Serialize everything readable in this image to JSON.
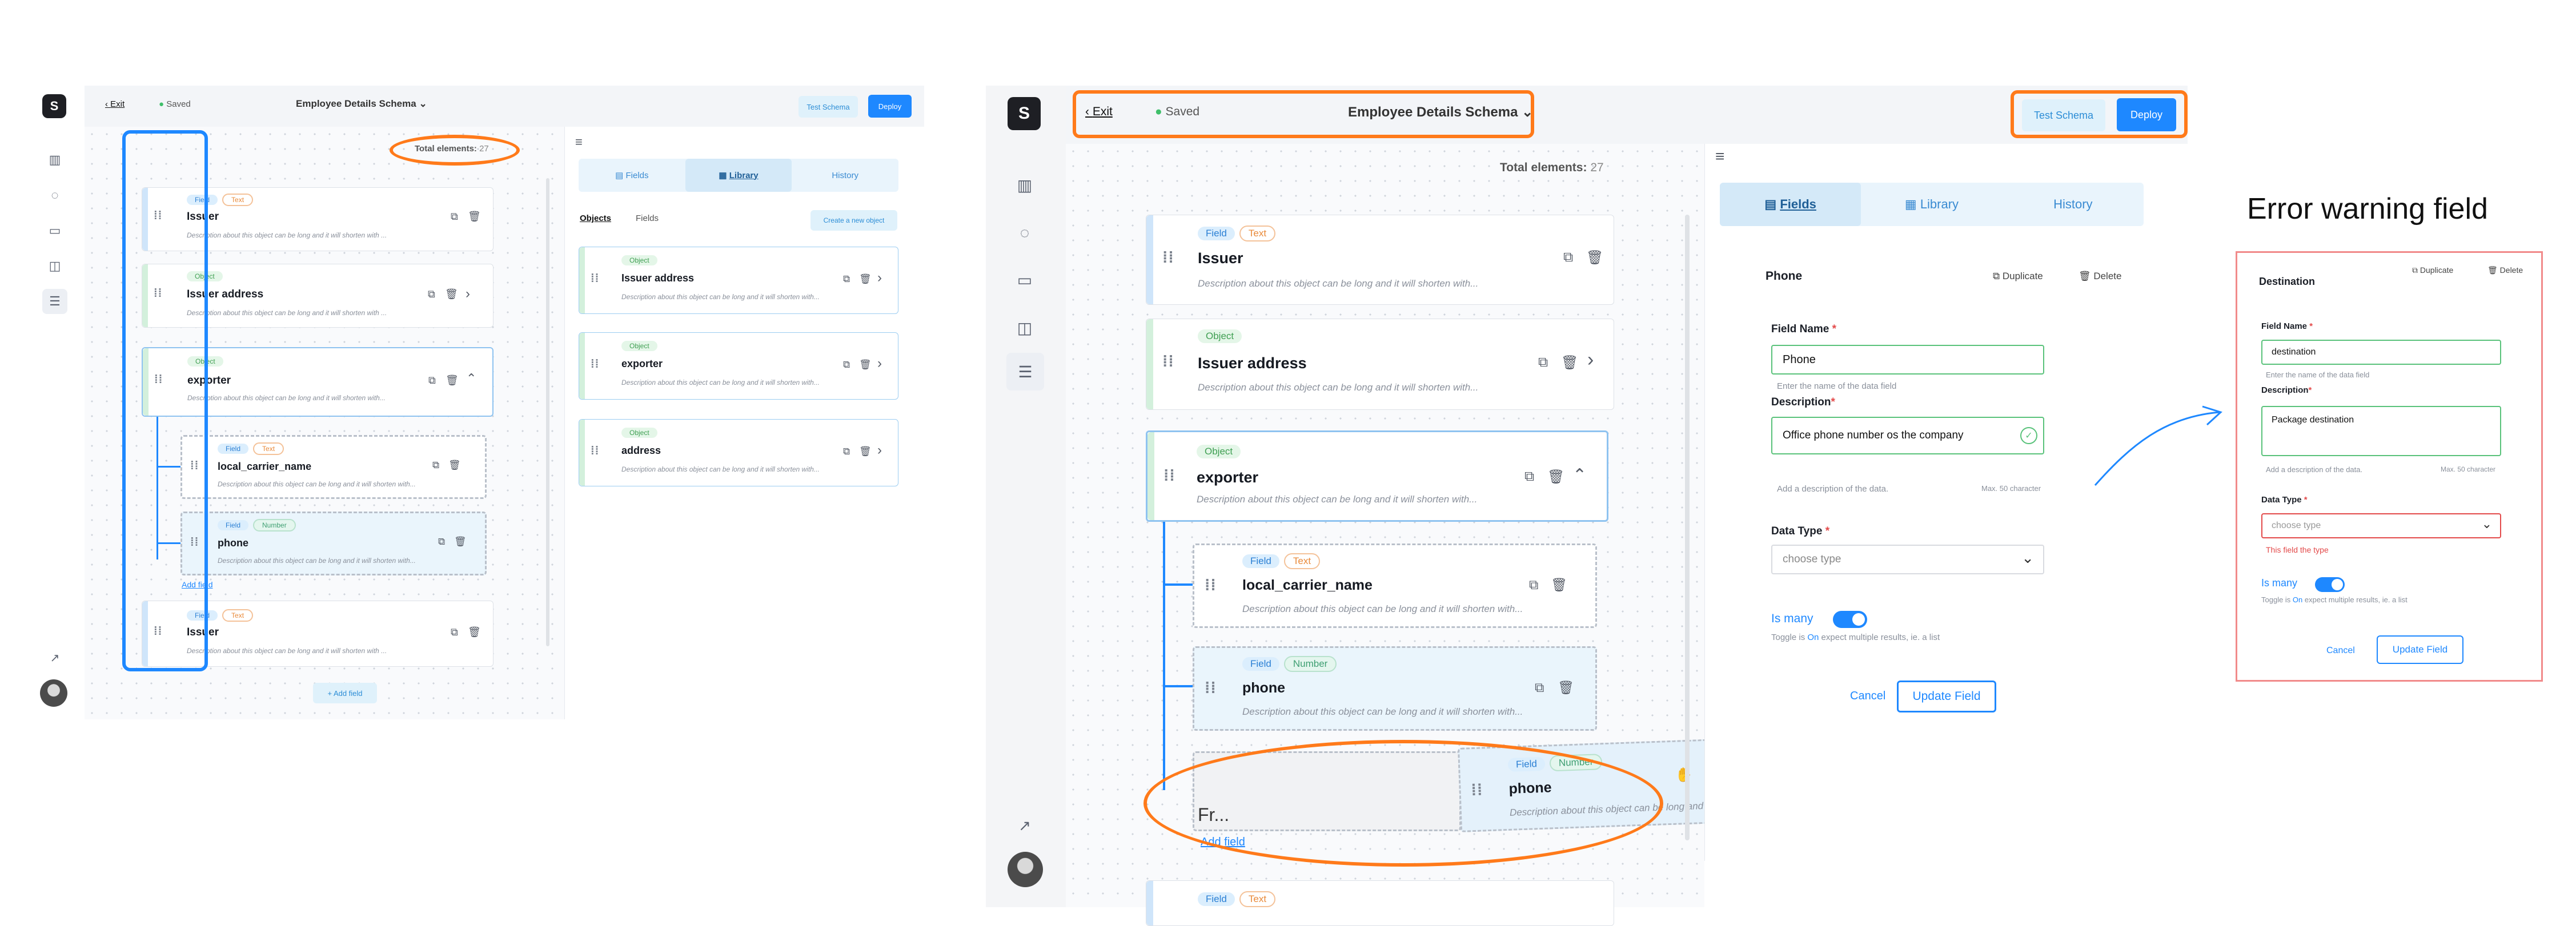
{
  "app": {
    "logo_glyph": "S",
    "exit_label": "Exit",
    "saved_label": "Saved",
    "schema_title": "Employee Details Schema",
    "test_schema_label": "Test Schema",
    "deploy_label": "Deploy",
    "total_label": "Total elements:",
    "total_value": "27"
  },
  "nav_icons": [
    "chart-icon",
    "chat-icon",
    "document-icon",
    "inbox-icon",
    "schema-icon"
  ],
  "left_cards": {
    "issuer": {
      "tag1": "Field",
      "tag2": "Text",
      "title": "Issuer",
      "desc": "Description about this object can be long and it will shorten with ..."
    },
    "issuer_address": {
      "tag1": "Object",
      "title": "Issuer address",
      "desc": "Description about this object can be long and it will shorten with ..."
    },
    "exporter": {
      "tag1": "Object",
      "title": "exporter",
      "desc": "Description about this object can be long and it will shorten with..."
    },
    "local_carrier": {
      "tag1": "Field",
      "tag2": "Text",
      "title": "local_carrier_name",
      "desc": "Description about this object can be long and it will shorten with..."
    },
    "phone": {
      "tag1": "Field",
      "tag2": "Number",
      "title": "phone",
      "desc": "Description about this object can be long and it will shorten with..."
    },
    "issuer2": {
      "tag1": "Field",
      "tag2": "Text",
      "title": "Issuer",
      "desc": "Description about this object can be long and it will shorten with ..."
    },
    "add_field_link": "Add field",
    "add_field_button": "+ Add field"
  },
  "library": {
    "tabs": [
      "Fields",
      "Library",
      "History"
    ],
    "subtabs": [
      "Objects",
      "Fields"
    ],
    "create_label": "Create a new object",
    "items": [
      {
        "tag": "Object",
        "title": "Issuer address",
        "desc": "Description about this object can be long and it will shorten with..."
      },
      {
        "tag": "Object",
        "title": "exporter",
        "desc": "Description about this object can be long and it will shorten with..."
      },
      {
        "tag": "Object",
        "title": "address",
        "desc": "Description about this object can be long and it will shorten with..."
      }
    ]
  },
  "middle_cards": {
    "issuer": {
      "tag1": "Field",
      "tag2": "Text",
      "title": "Issuer",
      "desc": "Description about this object can be long and it will shorten with..."
    },
    "issuer_address": {
      "tag1": "Object",
      "title": "Issuer address",
      "desc": "Description about this object can be long and it will shorten with..."
    },
    "exporter": {
      "tag1": "Object",
      "title": "exporter",
      "desc": "Description about this object can be long and it will shorten with..."
    },
    "local_carrier": {
      "tag1": "Field",
      "tag2": "Text",
      "title": "local_carrier_name",
      "desc": "Description about this object can be long and it will shorten with..."
    },
    "phone": {
      "tag1": "Field",
      "tag2": "Number",
      "title": "phone",
      "desc": "Description about this object can be long and it will shorten with..."
    },
    "placeholder_text": "Fr...",
    "drag": {
      "tag1": "Field",
      "tag2": "Number",
      "title": "phone",
      "desc": "Description about this object can be long and it will shorten with..."
    },
    "add_field_link": "Add field",
    "bottom": {
      "tag1": "Field",
      "tag2": "Text"
    }
  },
  "field_panel": {
    "tabs": [
      "Fields",
      "Library",
      "History"
    ],
    "heading": "Phone",
    "duplicate_label": "Duplicate",
    "delete_label": "Delete",
    "field_name_label": "Field Name",
    "field_name_value": "Phone",
    "field_name_hint": "Enter the name of the data field",
    "description_label": "Description",
    "description_value": "Office phone number os the company",
    "description_hint": "Add a description of the data.",
    "description_max": "Max. 50 character",
    "data_type_label": "Data Type",
    "data_type_placeholder": "choose type",
    "is_many_label": "Is many",
    "is_many_hint_pre": "Toggle is ",
    "is_many_hint_on": "On",
    "is_many_hint_post": " expect multiple results, ie. a list",
    "cancel_label": "Cancel",
    "update_label": "Update Field"
  },
  "error_card": {
    "caption": "Error warning field",
    "heading": "Destination",
    "duplicate_label": "Duplicate",
    "delete_label": "Delete",
    "field_name_label": "Field Name",
    "field_name_value": "destination",
    "field_name_hint": "Enter the name of the data field",
    "description_label": "Description",
    "description_value": "Package destination",
    "description_hint": "Add a description of the data.",
    "description_max": "Max. 50 character",
    "data_type_label": "Data Type",
    "data_type_placeholder": "choose type",
    "error_text": "This field the type",
    "is_many_label": "Is many",
    "is_many_hint_pre": "Toggle is ",
    "is_many_hint_on": "On",
    "is_many_hint_post": " expect multiple results, ie. a list",
    "cancel_label": "Cancel",
    "update_label": "Update Field"
  },
  "colors": {
    "accent": "#1e88ff",
    "highlight": "#ff7a1a",
    "error": "#e34a4a",
    "success": "#59c27a"
  }
}
